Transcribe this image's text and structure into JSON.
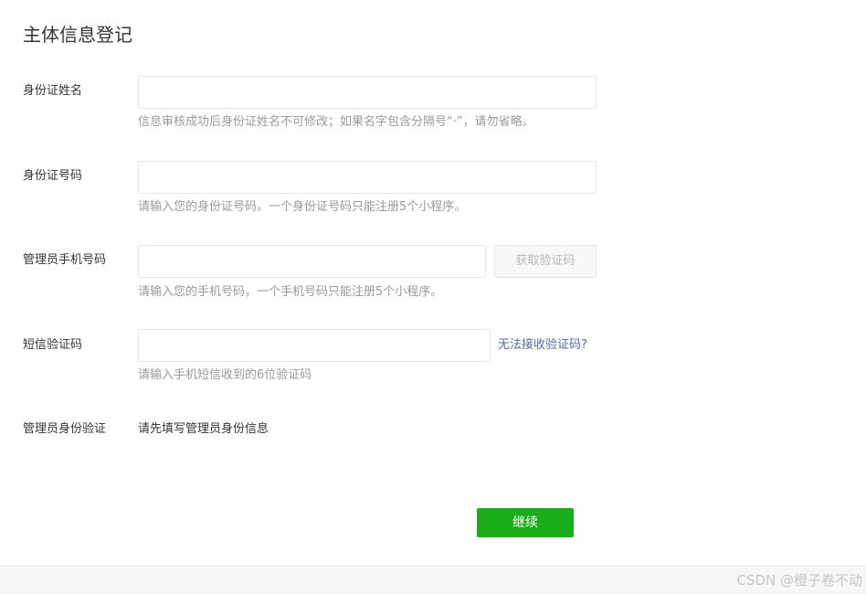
{
  "page": {
    "title": "主体信息登记"
  },
  "form": {
    "id_name": {
      "label": "身份证姓名",
      "value": "",
      "placeholder": "",
      "hint": "信息审核成功后身份证姓名不可修改；如果名字包含分隔号“·”，请勿省略。"
    },
    "id_number": {
      "label": "身份证号码",
      "value": "",
      "placeholder": "",
      "hint": "请输入您的身份证号码。一个身份证号码只能注册5个小程序。"
    },
    "admin_phone": {
      "label": "管理员手机号码",
      "value": "",
      "placeholder": "",
      "get_code_label": "获取验证码",
      "hint": "请输入您的手机号码，一个手机号码只能注册5个小程序。"
    },
    "sms_code": {
      "label": "短信验证码",
      "value": "",
      "placeholder": "",
      "link_label": "无法接收验证码?",
      "hint": "请输入手机短信收到的6位验证码"
    },
    "admin_verify": {
      "label": "管理员身份验证",
      "text": "请先填写管理员身份信息"
    },
    "continue_label": "继续"
  },
  "watermark": {
    "text": "CSDN @橙子卷不动"
  },
  "colors": {
    "primary_button": "#1aad19",
    "link": "#576b95",
    "hint_text": "#9a9a9a",
    "input_border": "#e4e8eb"
  }
}
